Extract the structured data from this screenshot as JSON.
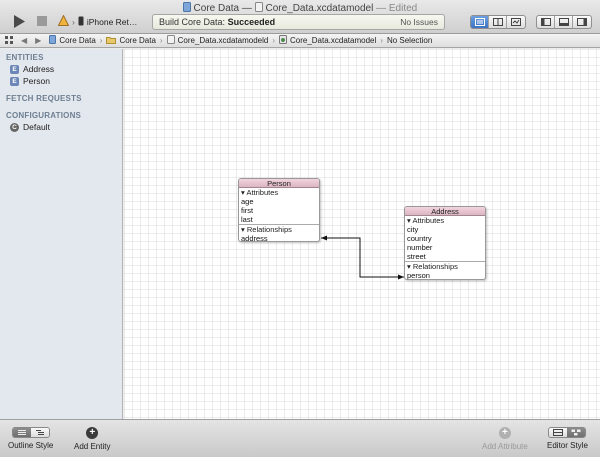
{
  "window": {
    "title_name": "Core Data",
    "title_sep": " — ",
    "file_name": "Core_Data.xcdatamodel",
    "edited": "— Edited"
  },
  "toolbar": {
    "scheme_target": "iPhone Ret…",
    "status_label": "Build Core Data:",
    "status_value": "Succeeded",
    "issues": "No Issues"
  },
  "jumpbar": {
    "crumbs": [
      "Core Data",
      "Core Data",
      "Core_Data.xcdatamodeld",
      "Core_Data.xcdatamodel",
      "No Selection"
    ]
  },
  "sidebar": {
    "entities_header": "ENTITIES",
    "entities": [
      {
        "badge": "E",
        "label": "Address"
      },
      {
        "badge": "E",
        "label": "Person"
      }
    ],
    "fetch_header": "FETCH REQUESTS",
    "config_header": "CONFIGURATIONS",
    "configurations": [
      {
        "badge": "C",
        "label": "Default"
      }
    ]
  },
  "diagram": {
    "person": {
      "name": "Person",
      "attributes_label": "Attributes",
      "attributes": [
        "age",
        "first",
        "last"
      ],
      "relationships_label": "Relationships",
      "relationships": [
        "address"
      ]
    },
    "address": {
      "name": "Address",
      "attributes_label": "Attributes",
      "attributes": [
        "city",
        "country",
        "number",
        "street"
      ],
      "relationships_label": "Relationships",
      "relationships": [
        "person"
      ]
    }
  },
  "bottombar": {
    "outline_style": "Outline Style",
    "add_entity": "Add Entity",
    "add_attribute": "Add Attribute",
    "editor_style": "Editor Style"
  },
  "colors": {
    "entity_header": "#dcb5c2",
    "sidebar_bg": "#e3e8ee",
    "section_header": "#6e7f92"
  }
}
